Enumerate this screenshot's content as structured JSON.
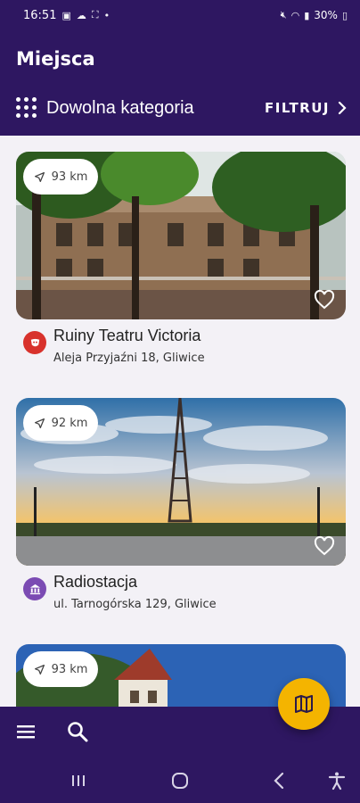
{
  "status_bar": {
    "time": "16:51",
    "battery": "30%"
  },
  "header": {
    "title": "Miejsca",
    "category": "Dowolna kategoria",
    "filter_label": "FILTRUJ"
  },
  "places": [
    {
      "distance": "93 km",
      "name": "Ruiny Teatru Victoria",
      "address": "Aleja Przyjaźni 18, Gliwice",
      "category_icon": "theater-icon",
      "category_color": "#d8322c"
    },
    {
      "distance": "92 km",
      "name": "Radiostacja",
      "address": "ul. Tarnogórska 129, Gliwice",
      "category_icon": "museum-icon",
      "category_color": "#7b4bb3"
    },
    {
      "distance": "93 km"
    }
  ],
  "bottom_bar": {
    "menu_icon": "menu-icon",
    "search_icon": "search-icon",
    "fab_icon": "map-icon"
  },
  "colors": {
    "primary": "#2e1761",
    "accent": "#f4b400",
    "background": "#f3f1f6"
  }
}
